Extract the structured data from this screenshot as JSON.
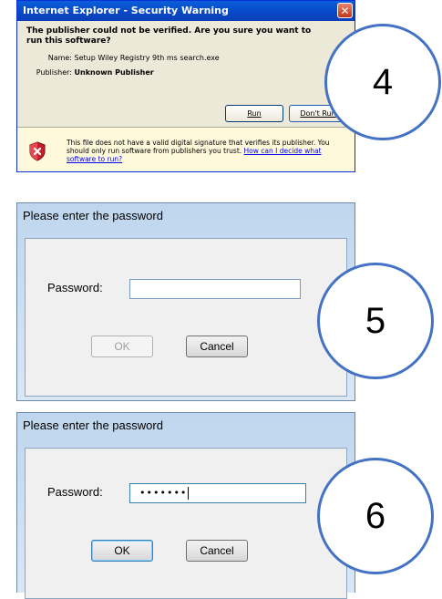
{
  "ie_warning": {
    "title": "Internet Explorer - Security Warning",
    "close_glyph": "✕",
    "question": "The publisher could not be verified.  Are you sure you want to run this software?",
    "name_label": "Name:",
    "name_value": "Setup Wiley Registry 9th ms search.exe",
    "publisher_label": "Publisher:",
    "publisher_value": "Unknown Publisher",
    "run_button": "Run",
    "dont_run_button": "Don't Run",
    "warning_text": "This file does not have a valid digital signature that verifies its publisher.  You should only run software from publishers you trust.",
    "help_link": "How can I decide what software to run?",
    "shield_icon": "shield-icon"
  },
  "password_dialog_empty": {
    "title": "Please enter the password",
    "password_label": "Password:",
    "password_value": "",
    "ok_button": "OK",
    "cancel_button": "Cancel"
  },
  "password_dialog_filled": {
    "title": "Please enter the password",
    "password_label": "Password:",
    "password_value": "•••••••",
    "ok_button": "OK",
    "cancel_button": "Cancel"
  },
  "steps": [
    "4",
    "5",
    "6"
  ],
  "colors": {
    "step_circle": "#4472c4",
    "ie_titlebar": "#0a5ed9",
    "vista_frame": "#bfd6ee"
  }
}
